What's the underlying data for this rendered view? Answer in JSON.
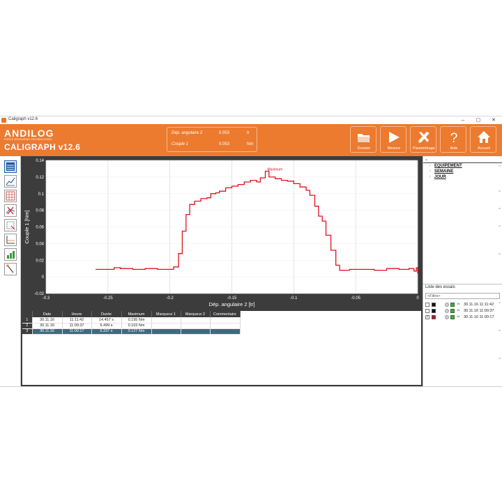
{
  "window": {
    "title": "Caligraph v12.6",
    "minimize": "–",
    "maximize": "▢",
    "close": "✕"
  },
  "header": {
    "brand": "ANDILOG",
    "tagline": "FORCE MEASURING TECHNOLOGIES",
    "app_name": "CALIGRAPH v12.6",
    "readout": [
      {
        "label": "Dép. angulaire 2",
        "value": "0.053",
        "unit": "tr"
      },
      {
        "label": "Couple 1",
        "value": "0.053",
        "unit": "Nm"
      }
    ],
    "buttons": [
      {
        "id": "dossier",
        "label": "Dossier",
        "icon": "folder-icon"
      },
      {
        "id": "mesure",
        "label": "Mesure",
        "icon": "play-icon"
      },
      {
        "id": "parametrage",
        "label": "Paramétrage",
        "icon": "tools-icon"
      },
      {
        "id": "aide",
        "label": "Aide",
        "icon": "question-icon"
      },
      {
        "id": "accueil",
        "label": "Accueil",
        "icon": "home-icon"
      }
    ],
    "colors": {
      "header_orange": "#ec7a2f"
    }
  },
  "left_toolbar": [
    {
      "icon": "table-view-icon",
      "active": true
    },
    {
      "icon": "curve-view-icon",
      "active": false
    },
    {
      "icon": "grid-view-icon",
      "active": false
    },
    {
      "icon": "delete-curve-icon",
      "active": false
    },
    {
      "icon": "zoom-region-icon",
      "active": false
    },
    {
      "icon": "axes-icon",
      "active": false
    },
    {
      "icon": "statistics-icon",
      "active": false
    },
    {
      "icon": "marker-icon",
      "active": false
    }
  ],
  "chart_data": {
    "type": "line",
    "title": "",
    "xlabel": "Dép. angulaire 2 [tr]",
    "ylabel": "Couple 1 [Nm]",
    "xlim": [
      -0.3,
      0
    ],
    "ylim": [
      -0.02,
      0.14
    ],
    "xticks": [
      "-0.3",
      "-0.25",
      "-0.2",
      "-0.15",
      "-0.1",
      "-0.05",
      "0"
    ],
    "yticks": [
      "-0.02",
      "0",
      "0.02",
      "0.04",
      "0.06",
      "0.08",
      "0.1",
      "0.12",
      "0.14"
    ],
    "grid": true,
    "annotation": {
      "text": "Maximum",
      "x": -0.123,
      "y": 0.127
    },
    "series": [
      {
        "color": "#e0101c",
        "points": [
          [
            -0.26,
            0.009
          ],
          [
            -0.25,
            0.009
          ],
          [
            -0.245,
            0.011
          ],
          [
            -0.24,
            0.01
          ],
          [
            -0.23,
            0.009
          ],
          [
            -0.22,
            0.01
          ],
          [
            -0.21,
            0.009
          ],
          [
            -0.2,
            0.009
          ],
          [
            -0.197,
            0.012
          ],
          [
            -0.193,
            0.028
          ],
          [
            -0.19,
            0.055
          ],
          [
            -0.187,
            0.075
          ],
          [
            -0.184,
            0.087
          ],
          [
            -0.18,
            0.091
          ],
          [
            -0.175,
            0.094
          ],
          [
            -0.17,
            0.095
          ],
          [
            -0.167,
            0.1
          ],
          [
            -0.163,
            0.101
          ],
          [
            -0.16,
            0.103
          ],
          [
            -0.155,
            0.107
          ],
          [
            -0.15,
            0.109
          ],
          [
            -0.145,
            0.111
          ],
          [
            -0.14,
            0.114
          ],
          [
            -0.135,
            0.116
          ],
          [
            -0.13,
            0.114
          ],
          [
            -0.127,
            0.119
          ],
          [
            -0.123,
            0.127
          ],
          [
            -0.12,
            0.12
          ],
          [
            -0.115,
            0.118
          ],
          [
            -0.11,
            0.116
          ],
          [
            -0.105,
            0.115
          ],
          [
            -0.1,
            0.112
          ],
          [
            -0.095,
            0.108
          ],
          [
            -0.09,
            0.104
          ],
          [
            -0.087,
            0.098
          ],
          [
            -0.083,
            0.085
          ],
          [
            -0.08,
            0.073
          ],
          [
            -0.077,
            0.067
          ],
          [
            -0.074,
            0.05
          ],
          [
            -0.07,
            0.032
          ],
          [
            -0.066,
            0.014
          ],
          [
            -0.063,
            0.008
          ],
          [
            -0.055,
            0.009
          ],
          [
            -0.045,
            0.009
          ],
          [
            -0.035,
            0.008
          ],
          [
            -0.025,
            0.01
          ],
          [
            -0.015,
            0.009
          ],
          [
            -0.007,
            0.01
          ],
          [
            -0.003,
            0.007
          ],
          [
            -0.001,
            0.011
          ],
          [
            0,
            0.004
          ]
        ]
      }
    ],
    "table": {
      "columns": [
        "",
        "Date",
        "Heure",
        "Durée",
        "Maximum",
        "Marqueur 1",
        "Marqueur 2",
        "Commentaire"
      ],
      "rows": [
        [
          "1",
          "30.11.16",
          "11:11:42",
          "14.457 s",
          "0.195 Nm",
          "",
          "",
          ""
        ],
        [
          "2",
          "30.11.16",
          "11:00:37",
          "6.499 s",
          "0.103 Nm",
          "",
          "",
          ""
        ],
        [
          "3",
          "30.11.16",
          "11:00:17",
          "6.337 s",
          "0.127 Nm",
          "",
          "",
          ""
        ]
      ],
      "selected_row": 2
    }
  },
  "right_panel": {
    "tree": [
      "EQUIPEMENT",
      "SEMAINE",
      "JOUR"
    ],
    "essais_title": "Liste des essais",
    "filter_placeholder": "<Filtre>",
    "essais": [
      {
        "checked": false,
        "color": "#111111",
        "datetime": "30.11.16 11:11:42"
      },
      {
        "checked": false,
        "color": "#111111",
        "datetime": "30.11.16 11:00:37"
      },
      {
        "checked": true,
        "color": "#c0102a",
        "datetime": "30.11.16 11:00:17"
      }
    ]
  }
}
